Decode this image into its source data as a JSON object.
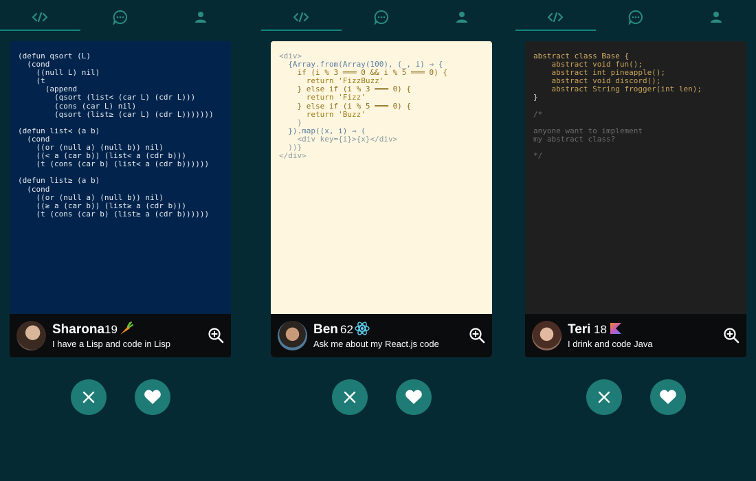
{
  "colors": {
    "background": "#062a33",
    "accent": "#1e7b76",
    "tab_icon": "#2a8b83",
    "card_lisp_bg": "#02244c",
    "card_react_bg": "#fff6df",
    "card_java_bg": "#1f1f1f",
    "profile_bg": "#0b0c0d"
  },
  "tabs": [
    {
      "icon": "code-icon",
      "active": true
    },
    {
      "icon": "chat-icon",
      "active": false
    },
    {
      "icon": "person-icon",
      "active": false
    }
  ],
  "cards": [
    {
      "name": "Sharona",
      "age": "19",
      "badge_icon": "carrot-icon",
      "bio": "I have a Lisp and code in Lisp",
      "language": "Lisp",
      "code_lines": [
        "(defun qsort (L)",
        "  (cond",
        "    ((null L) nil)",
        "    (t",
        "      (append",
        "        (qsort (list< (car L) (cdr L)))",
        "        (cons (car L) nil)",
        "        (qsort (list≥ (car L) (cdr L)))))))",
        "",
        "(defun list< (a b)",
        "  (cond",
        "    ((or (null a) (null b)) nil)",
        "    ((< a (car b)) (list< a (cdr b)))",
        "    (t (cons (car b) (list< a (cdr b))))))",
        "",
        "(defun list≥ (a b)",
        "  (cond",
        "    ((or (null a) (null b)) nil)",
        "    ((≥ a (car b)) (list≥ a (cdr b)))",
        "    (t (cons (car b) (list≥ a (cdr b))))))"
      ]
    },
    {
      "name": "Ben",
      "age": "62",
      "badge_icon": "react-atom-icon",
      "bio": "Ask me about my React.js code",
      "language": "JavaScript",
      "code_lines": [
        "<div>",
        "  {Array.from(Array(100), (_, i) ⇒ {",
        "    if (i % 3 ═══ 0 && i % 5 ═══ 0) {",
        "      return 'FizzBuzz'",
        "    } else if (i % 3 ═══ 0) {",
        "      return 'Fizz'",
        "    } else if (i % 5 ═══ 0) {",
        "      return 'Buzz'",
        "    }",
        "  }).map((x, i) ⇒ (",
        "    <div key={i}>{x}</div>",
        "  ))}",
        "</div>"
      ]
    },
    {
      "name": "Teri",
      "age": "18",
      "badge_icon": "kotlin-logo-icon",
      "bio": "I drink and code Java",
      "language": "Java",
      "code_lines": [
        "abstract class Base {",
        "    abstract void fun();",
        "    abstract int pineapple();",
        "    abstract void discord();",
        "    abstract String frogger(int len);",
        "}",
        "",
        "/*",
        "",
        "anyone want to implement",
        "my abstract class?",
        "",
        "*/"
      ]
    }
  ],
  "actions": [
    {
      "icon": "close-x-icon"
    },
    {
      "icon": "heart-icon"
    }
  ]
}
